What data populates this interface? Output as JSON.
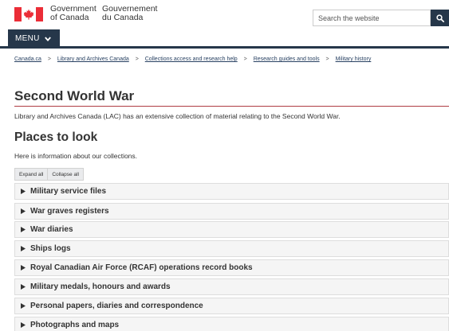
{
  "header": {
    "wordmark_en_line1": "Government",
    "wordmark_en_line2": "of Canada",
    "wordmark_fr_line1": "Gouvernement",
    "wordmark_fr_line2": "du Canada",
    "search_placeholder": "Search the website",
    "search_icon": "search-icon",
    "flag_color": "#eb2d37",
    "nav_color": "#26374a"
  },
  "menu": {
    "label": "MENU",
    "icon": "chevron-down-icon"
  },
  "breadcrumb": {
    "items": [
      "Canada.ca",
      "Library and Archives Canada",
      "Collections access and research help",
      "Research guides and tools",
      "Military history"
    ],
    "separator": ">"
  },
  "page": {
    "title": "Second World War",
    "intro": "Library and Archives Canada (LAC) has an extensive collection of material relating to the Second World War.",
    "section_title": "Places to look",
    "section_info": "Here is information about our collections.",
    "rule_color": "#af3c43"
  },
  "controls": {
    "expand_all": "Expand all",
    "collapse_all": "Collapse all"
  },
  "accordion": {
    "icon": "triangle-right-icon",
    "items": [
      "Military service files",
      "War graves registers",
      "War diaries",
      "Ships logs",
      "Royal Canadian Air Force (RCAF) operations record books",
      "Military medals, honours and awards",
      "Personal papers, diaries and correspondence",
      "Photographs and maps"
    ]
  }
}
